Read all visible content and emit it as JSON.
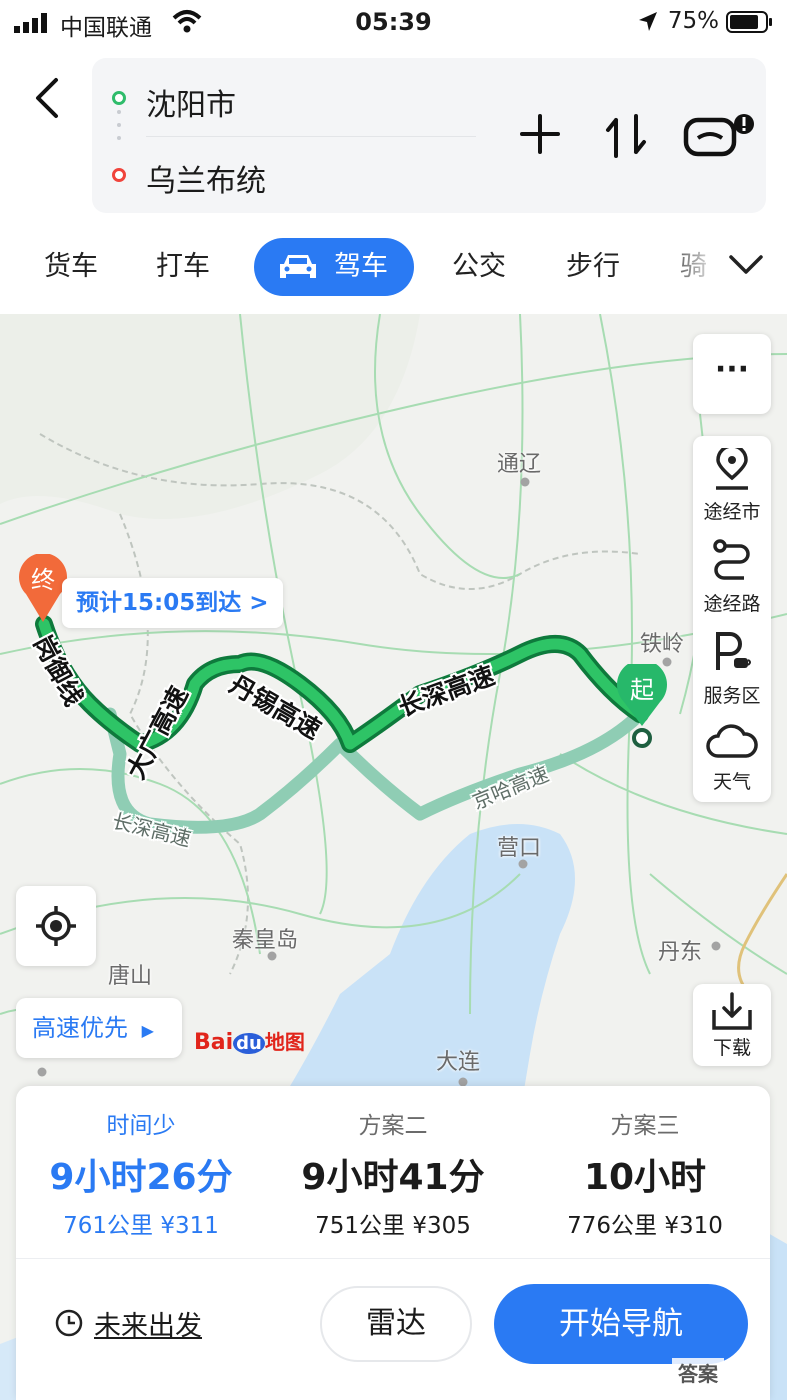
{
  "status": {
    "carrier": "中国联通",
    "time": "05:39",
    "battery": "75%"
  },
  "route": {
    "from": "沈阳市",
    "to": "乌兰布统"
  },
  "tabs": [
    "货车",
    "打车",
    "驾车",
    "公交",
    "步行",
    "骑"
  ],
  "active_tab": "驾车",
  "map": {
    "cities": [
      "通辽",
      "铁岭",
      "营口",
      "秦皇岛",
      "唐山",
      "丹东",
      "大连"
    ],
    "roads": {
      "main1": "丹锡高速",
      "main2": "长深高速",
      "main3": "大广高速",
      "main4": "岗御线",
      "alt1": "京哈高速",
      "alt2": "长深高速"
    },
    "eta": "预计15:05到达 >",
    "pin_end": "终",
    "pin_start": "起",
    "preference": "高速优先",
    "logo_bai": "Bai",
    "logo_du": "du",
    "logo_map": "地图"
  },
  "tools": {
    "more": "···",
    "via_city": "途经市",
    "via_road": "途经路",
    "service": "服务区",
    "weather": "天气",
    "download": "下载"
  },
  "plans": [
    {
      "label": "时间少",
      "time": "9小时26分",
      "detail": "761公里 ¥311"
    },
    {
      "label": "方案二",
      "time": "9小时41分",
      "detail": "751公里 ¥305"
    },
    {
      "label": "方案三",
      "time": "10小时",
      "detail": "776公里 ¥310"
    }
  ],
  "actions": {
    "future": "未来出发",
    "radar": "雷达",
    "navigate": "开始导航"
  },
  "watermark": "答案",
  "colors": {
    "accent": "#2a7af3",
    "route": "#1fae5c",
    "route_alt": "#8fcdb4",
    "start": "#2fbc6b",
    "end": "#f0443c"
  }
}
